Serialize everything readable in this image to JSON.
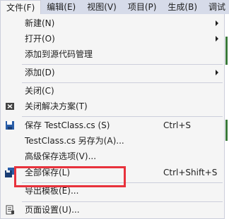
{
  "menubar": {
    "items": [
      {
        "label": "文件(F)"
      },
      {
        "label": "编辑(E)"
      },
      {
        "label": "视图(V)"
      },
      {
        "label": "项目(P)"
      },
      {
        "label": "生成(B)"
      },
      {
        "label": "调试"
      }
    ]
  },
  "menu": {
    "new": {
      "label": "新建(N)",
      "icon": "none"
    },
    "open": {
      "label": "打开(O)",
      "icon": "none"
    },
    "add_source_control": {
      "label": "添加到源代码管理",
      "icon": "none"
    },
    "add": {
      "label": "添加(D)",
      "icon": "none"
    },
    "close": {
      "label": "关闭(C)",
      "icon": "none"
    },
    "close_solution": {
      "label": "关闭解决方案(T)",
      "icon": "close-solution-icon"
    },
    "save": {
      "label": "保存 TestClass.cs (S)",
      "shortcut": "Ctrl+S",
      "icon": "save-icon"
    },
    "save_as": {
      "label": "TestClass.cs 另存为(A)...",
      "icon": "none"
    },
    "advanced_save": {
      "label": "高级保存选项(V)...",
      "icon": "none"
    },
    "save_all": {
      "label": "全部保存(L)",
      "shortcut": "Ctrl+Shift+S",
      "icon": "save-all-icon"
    },
    "export_template": {
      "label": "导出模板(E)...",
      "icon": "none"
    },
    "page_setup": {
      "label": "页面设置(U)...",
      "icon": "page-setup-icon"
    }
  },
  "colors": {
    "highlight_box": "#e8323c",
    "menubar_bg": "#d6dbe9",
    "menu_bg": "#f5f5f5"
  }
}
